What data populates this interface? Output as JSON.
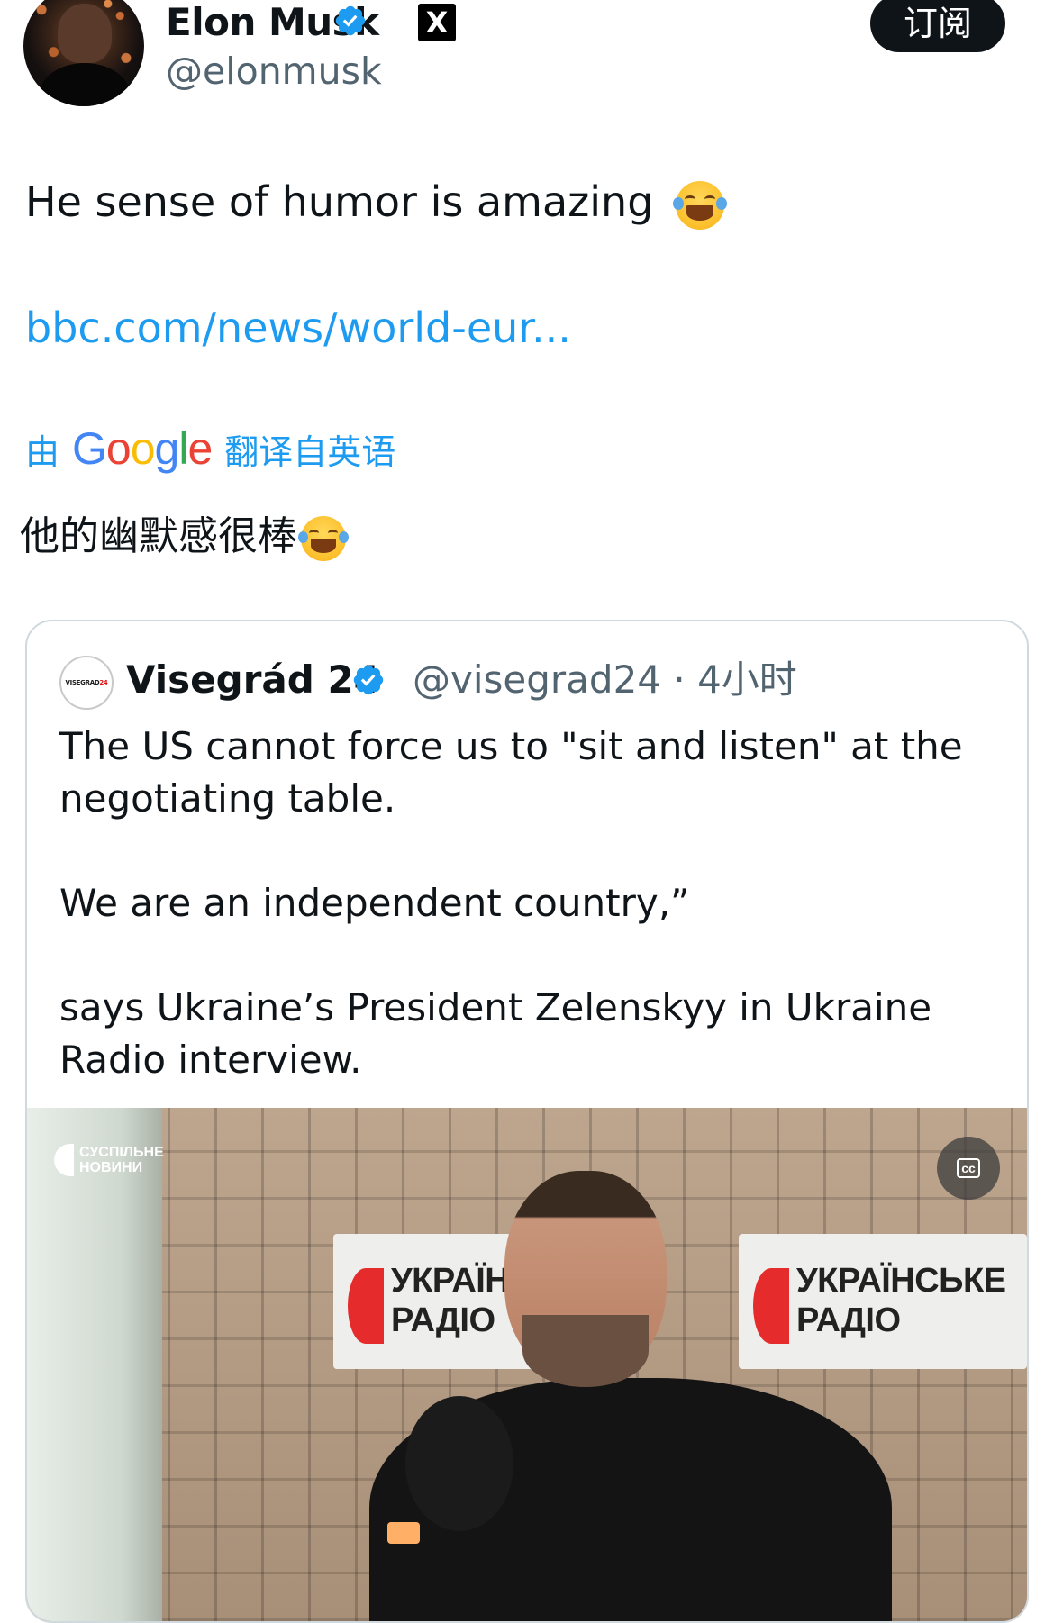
{
  "author": {
    "name": "Elon Musk",
    "handle": "@elonmusk",
    "verified_icon": "verified-badge-icon",
    "affiliate_icon": "x-logo-icon",
    "affiliate_glyph": "X"
  },
  "subscribe_label": "订阅",
  "tweet": {
    "text": "He sense of humor is amazing",
    "emoji_icon": "face-with-tears-of-joy-icon",
    "link": "bbc.com/news/world-eur..."
  },
  "translation": {
    "prefix": "由",
    "provider": "Google",
    "suffix": "翻译自英语",
    "text": "他的幽默感很棒"
  },
  "quote": {
    "avatar_text_main": "VISEGRAD",
    "avatar_text_num": "24",
    "name": "Visegrád 24",
    "handle_time": "@visegrad24 · 4小时",
    "paragraphs": [
      "The US cannot force us to \"sit and listen\" at the negotiating table.",
      "We are an independent country,”",
      "says Ukraine’s President Zelenskyy in Ukraine Radio interview."
    ],
    "video": {
      "brand_line1": "СУСПІЛЬНЕ",
      "brand_line2": "НОВИНИ",
      "sign_left_line1": "УКРАЇНСЬ",
      "sign_left_line2": "РАДІО",
      "sign_right_line1": "УКРАЇНСЬКЕ",
      "sign_right_line2": "РАДІО",
      "cc_label": "cc"
    }
  },
  "colors": {
    "link": "#1d9bf0",
    "verified": "#1d9bf0",
    "secondary_text": "#536471",
    "subscribe_bg": "#0f1419"
  }
}
